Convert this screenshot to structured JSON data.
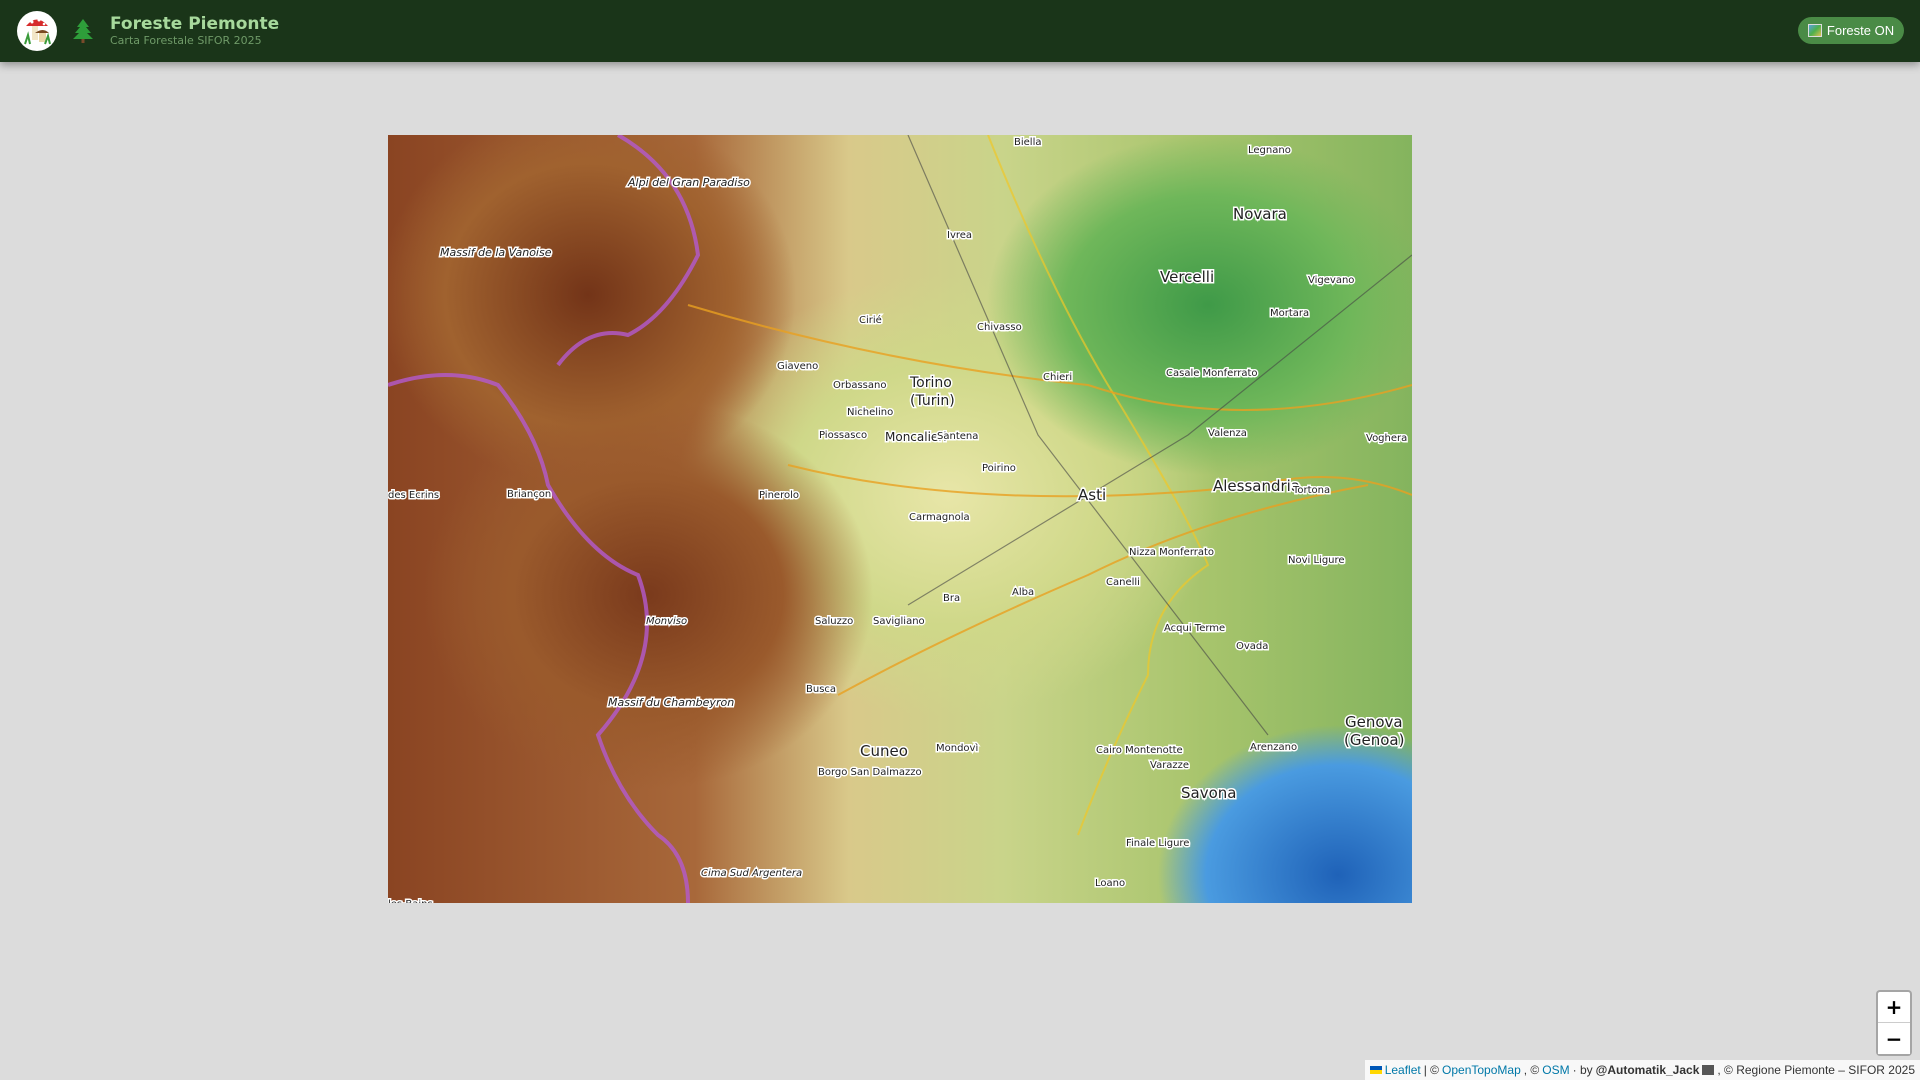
{
  "header": {
    "title": "Foreste Piemonte",
    "subtitle": "Carta Forestale SIFOR 2025",
    "toggle_label": "Foreste ON"
  },
  "map": {
    "labels": [
      {
        "text": "Torino",
        "size": 14
      },
      {
        "text": "(Turin)",
        "size": 14
      },
      {
        "text": "Asti",
        "size": 15
      },
      {
        "text": "Alessandria",
        "size": 15
      },
      {
        "text": "Cuneo",
        "size": 15
      },
      {
        "text": "Vercelli",
        "size": 15
      },
      {
        "text": "Novara",
        "size": 15
      },
      {
        "text": "Genova",
        "size": 15
      },
      {
        "text": "(Genoa)",
        "size": 15
      },
      {
        "text": "Savona",
        "size": 15
      },
      {
        "text": "Moncalieri",
        "size": 12
      },
      {
        "text": "Pinerolo",
        "size": 10
      },
      {
        "text": "Saluzzo",
        "size": 10
      },
      {
        "text": "Savigliano",
        "size": 10
      },
      {
        "text": "Mondovì",
        "size": 10
      },
      {
        "text": "Alba",
        "size": 10
      },
      {
        "text": "Bra",
        "size": 10
      },
      {
        "text": "Ivrea",
        "size": 10
      },
      {
        "text": "Chivasso",
        "size": 10
      },
      {
        "text": "Carmagnola",
        "size": 10
      },
      {
        "text": "Casale Monferrato",
        "size": 10
      },
      {
        "text": "Valenza",
        "size": 10
      },
      {
        "text": "Tortona",
        "size": 10
      },
      {
        "text": "Novi Ligure",
        "size": 10
      },
      {
        "text": "Acqui Terme",
        "size": 10
      },
      {
        "text": "Ovada",
        "size": 10
      },
      {
        "text": "Vigevano",
        "size": 10
      },
      {
        "text": "Mortara",
        "size": 10
      },
      {
        "text": "Legnano",
        "size": 10
      },
      {
        "text": "Biella",
        "size": 10
      },
      {
        "text": "Nizza Monferrato",
        "size": 10
      },
      {
        "text": "Canelli",
        "size": 10
      },
      {
        "text": "Cairo Montenotte",
        "size": 10
      },
      {
        "text": "Varazze",
        "size": 10
      },
      {
        "text": "Arenzano",
        "size": 10
      },
      {
        "text": "Finale Ligure",
        "size": 10
      },
      {
        "text": "Loano",
        "size": 10
      },
      {
        "text": "Borgo San Dalmazzo",
        "size": 10
      },
      {
        "text": "Busca",
        "size": 10
      },
      {
        "text": "Briançon",
        "size": 10
      },
      {
        "text": "Monviso",
        "size": 10
      },
      {
        "text": "Massif de la Vanoise",
        "size": 11
      },
      {
        "text": "Massif du Chambeyron",
        "size": 11
      },
      {
        "text": "Alpi del Gran Paradiso",
        "size": 11
      },
      {
        "text": "Cima Sud Argentera",
        "size": 10
      },
      {
        "text": "Giaveno",
        "size": 10
      },
      {
        "text": "Chieri",
        "size": 10
      },
      {
        "text": "Orbassano",
        "size": 10
      },
      {
        "text": "Nichelino",
        "size": 10
      },
      {
        "text": "Piossasco",
        "size": 10
      },
      {
        "text": "Santena",
        "size": 10
      },
      {
        "text": "Poirino",
        "size": 10
      },
      {
        "text": "Cirié",
        "size": 10
      },
      {
        "text": "Voghera",
        "size": 10
      },
      {
        "text": "des Ecrins",
        "size": 10
      },
      {
        "text": "les-Bains",
        "size": 10
      }
    ],
    "zoom_in": "+",
    "zoom_out": "−"
  },
  "attribution": {
    "leaflet": "Leaflet",
    "sep1": "| ©",
    "opentopomap": "OpenTopoMap",
    "sep2": ", ©",
    "osm": "OSM",
    "by": "· by",
    "author": "@Automatik_Jack",
    "rest": ", © Regione Piemonte – SIFOR 2025"
  }
}
